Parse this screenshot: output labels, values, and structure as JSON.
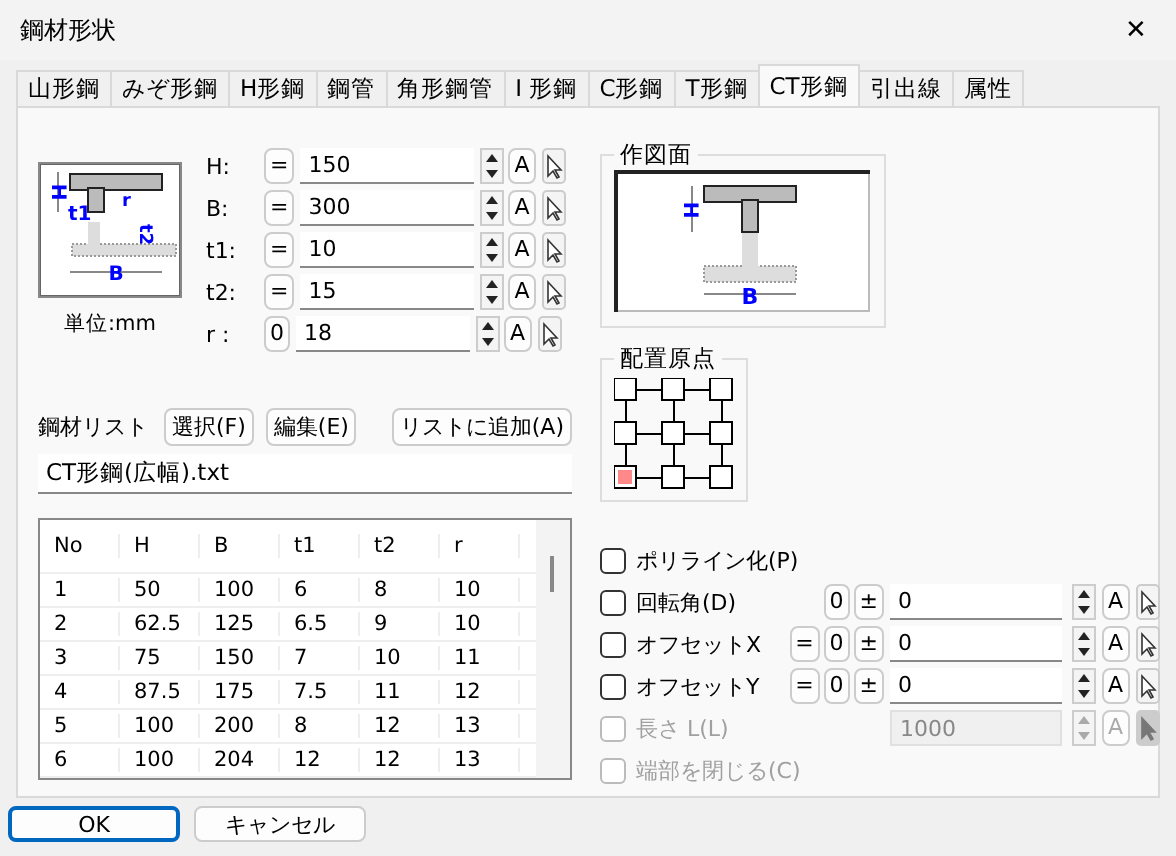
{
  "window": {
    "title": "鋼材形状",
    "close": "✕"
  },
  "tabs": [
    {
      "label": "山形鋼",
      "selected": false
    },
    {
      "label": "みぞ形鋼",
      "selected": false
    },
    {
      "label": "H形鋼",
      "selected": false
    },
    {
      "label": "鋼管",
      "selected": false
    },
    {
      "label": "角形鋼管",
      "selected": false
    },
    {
      "label": "I 形鋼",
      "selected": false
    },
    {
      "label": "C形鋼",
      "selected": false
    },
    {
      "label": "T形鋼",
      "selected": false
    },
    {
      "label": "CT形鋼",
      "selected": true
    },
    {
      "label": "引出線",
      "selected": false
    },
    {
      "label": "属性",
      "selected": false
    }
  ],
  "section": {
    "labels": [
      "H",
      "t1",
      "r",
      "t2",
      "B"
    ],
    "unit": "単位:mm"
  },
  "params": [
    {
      "label": "H:",
      "mode": "=",
      "value": "150",
      "auto": "A"
    },
    {
      "label": "B:",
      "mode": "=",
      "value": "300",
      "auto": "A"
    },
    {
      "label": "t1:",
      "mode": "=",
      "value": "10",
      "auto": "A"
    },
    {
      "label": "t2:",
      "mode": "=",
      "value": "15",
      "auto": "A"
    },
    {
      "label": "r :",
      "mode": "0",
      "value": "18",
      "auto": "A"
    }
  ],
  "steel_list": {
    "label": "鋼材リスト",
    "buttons": [
      "選択(F)",
      "編集(E)",
      "リストに追加(A)"
    ],
    "file": "CT形鋼(広幅).txt"
  },
  "table": {
    "columns": [
      "No",
      "H",
      "B",
      "t1",
      "t2",
      "r"
    ],
    "rows": [
      [
        "1",
        "50",
        "100",
        "6",
        "8",
        "10"
      ],
      [
        "2",
        "62.5",
        "125",
        "6.5",
        "9",
        "10"
      ],
      [
        "3",
        "75",
        "150",
        "7",
        "10",
        "11"
      ],
      [
        "4",
        "87.5",
        "175",
        "7.5",
        "11",
        "12"
      ],
      [
        "5",
        "100",
        "200",
        "8",
        "12",
        "13"
      ],
      [
        "6",
        "100",
        "204",
        "12",
        "12",
        "13"
      ]
    ]
  },
  "preview": {
    "title": "作図面",
    "labels": [
      "H",
      "B"
    ]
  },
  "origin": {
    "title": "配置原点",
    "cells": [
      {
        "selected": false
      },
      {
        "selected": false
      },
      {
        "selected": false
      },
      {
        "selected": false
      },
      {
        "selected": false
      },
      {
        "selected": false
      },
      {
        "selected": true
      },
      {
        "selected": false
      },
      {
        "selected": false
      }
    ]
  },
  "options": [
    {
      "kind": "check",
      "label": "ポリライン化(P)",
      "checked": false,
      "disabled": false
    },
    {
      "kind": "value",
      "label": "回転角(D)",
      "checked": false,
      "disabled": false,
      "buttons": [
        "0",
        "±"
      ],
      "value": "0",
      "auto": "A"
    },
    {
      "kind": "value",
      "label": "オフセットX",
      "checked": false,
      "disabled": false,
      "buttons": [
        "=",
        "0",
        "±"
      ],
      "value": "0",
      "auto": "A"
    },
    {
      "kind": "value",
      "label": "オフセットY",
      "checked": false,
      "disabled": false,
      "buttons": [
        "=",
        "0",
        "±"
      ],
      "value": "0",
      "auto": "A"
    },
    {
      "kind": "value",
      "label": "長さ L(L)",
      "checked": false,
      "disabled": true,
      "value": "1000",
      "auto": "A"
    },
    {
      "kind": "check",
      "label": "端部を閉じる(C)",
      "checked": false,
      "disabled": true
    }
  ],
  "footer": [
    {
      "label": "OK",
      "focused": true
    },
    {
      "label": "キャンセル",
      "focused": false
    }
  ]
}
